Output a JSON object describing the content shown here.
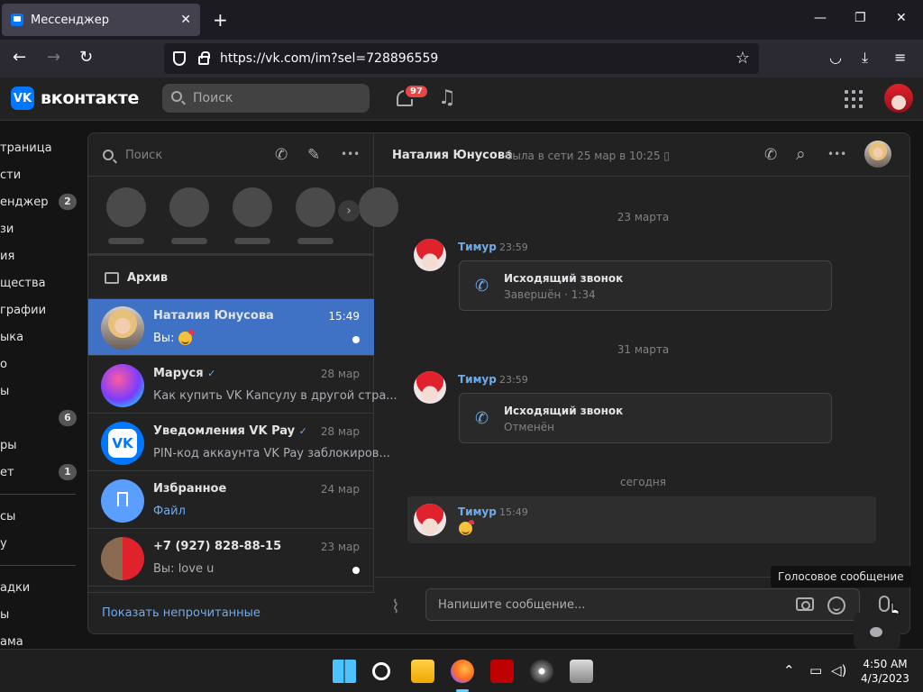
{
  "browser": {
    "tab_title": "Мессенджер",
    "tab_close": "✕",
    "new_tab": "+",
    "url": "https://vk.com/im?sel=728896559",
    "min": "—",
    "max": "❐",
    "close": "✕",
    "back": "←",
    "forward": "→",
    "reload": "↻",
    "star": "☆",
    "pocket": "◡",
    "download": "⤓",
    "menu": "≡"
  },
  "vk": {
    "logo": "VK",
    "brand": "вконтакте",
    "search_placeholder": "Поиск",
    "notifications_count": "97",
    "music_icon": "♫"
  },
  "left_nav": {
    "items": [
      {
        "label": "траница"
      },
      {
        "label": "сти"
      },
      {
        "label": "енджер",
        "count": "2"
      },
      {
        "label": "зи"
      },
      {
        "label": "ия"
      },
      {
        "label": "щества"
      },
      {
        "label": "графии"
      },
      {
        "label": "ыка"
      },
      {
        "label": "о"
      },
      {
        "label": "ы"
      },
      {
        "label": "",
        "count": "6"
      },
      {
        "label": "ры"
      },
      {
        "label": "ет",
        "count": "1"
      },
      {
        "label": "сы"
      },
      {
        "label": "у"
      },
      {
        "label": "адки"
      },
      {
        "label": "ы"
      },
      {
        "label": "ама"
      }
    ]
  },
  "chatlist": {
    "search_placeholder": "Поиск",
    "call_icon": "✆",
    "compose_icon": "✎",
    "more_icon": "•••",
    "story_next": "›",
    "archive_label": "Архив",
    "conversations": [
      {
        "name": "Наталия Юнусова",
        "time": "15:49",
        "preview": "Вы:",
        "active": true
      },
      {
        "name": "Маруся",
        "time": "28 мар",
        "preview": "Как купить VK Капсулу в другой стра..."
      },
      {
        "name": "Уведомления VK Pay",
        "time": "28 мар",
        "preview": "PIN-код аккаунта VK Pay заблокиров..."
      },
      {
        "name": "Избранное",
        "time": "24 мар",
        "preview": "Файл"
      },
      {
        "name": "+7 (927) 828-88-15",
        "time": "23 мар",
        "preview": "Вы: love u"
      }
    ],
    "verified_mark": "✓",
    "show_unread": "Показать непрочитанные"
  },
  "conversation": {
    "name": "Наталия Юнусова",
    "status": "была в сети 25 мар в 10:25",
    "phone_icon": "✆",
    "search_icon": "⌕",
    "more_icon": "•••",
    "mobile_icon": "▯",
    "messages": [
      {
        "date": "23 марта",
        "author": "Тимур",
        "time": "23:59",
        "call_title": "Исходящий звонок",
        "call_sub": "Завершён · 1:34"
      },
      {
        "date": "31 марта",
        "author": "Тимур",
        "time": "23:59",
        "call_title": "Исходящий звонок",
        "call_sub": "Отменён"
      },
      {
        "date": "сегодня",
        "author": "Тимур",
        "time": "15:49"
      }
    ],
    "call_glyph": "✆",
    "input_placeholder": "Напишите сообщение...",
    "clip_icon": "⌇",
    "tooltip": "Голосовое сообщение"
  },
  "taskbar": {
    "tray_up": "⌃",
    "tray_net": "▭",
    "tray_vol": "◁)",
    "time": "4:50 AM",
    "date": "4/3/2023"
  }
}
